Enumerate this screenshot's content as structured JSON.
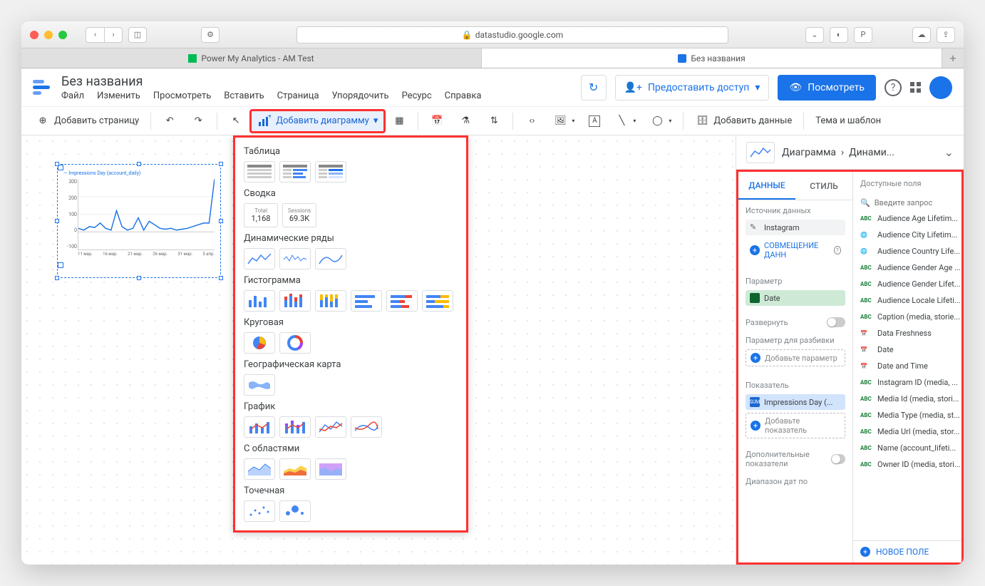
{
  "browser": {
    "url": "datastudio.google.com",
    "tabs": [
      {
        "label": "Power My Analytics - AM Test",
        "active": false
      },
      {
        "label": "Без названия",
        "active": true
      }
    ]
  },
  "doc_title": "Без названия",
  "menus": [
    "Файл",
    "Изменить",
    "Просмотреть",
    "Вставить",
    "Страница",
    "Упорядочить",
    "Ресурс",
    "Справка"
  ],
  "header_buttons": {
    "share": "Предоставить доступ",
    "view": "Посмотреть"
  },
  "toolbar": {
    "add_page": "Добавить страницу",
    "add_chart": "Добавить диаграмму",
    "add_data": "Добавить данные",
    "theme": "Тема и шаблон"
  },
  "dropdown": {
    "sections": {
      "table": "Таблица",
      "summary": "Сводка",
      "timeseries": "Динамические ряды",
      "histogram": "Гистограмма",
      "pie": "Круговая",
      "geo": "Географическая карта",
      "chart": "График",
      "area": "С областями",
      "scatter": "Точечная"
    },
    "summary_tiles": [
      {
        "label": "Total",
        "value": "1,168"
      },
      {
        "label": "Sessions",
        "value": "69.3K"
      }
    ]
  },
  "chart_data": {
    "type": "line",
    "title": "",
    "legend": "Impressions Day (account_daily)",
    "xlabel": "",
    "ylabel": "",
    "ylim": [
      -100,
      300
    ],
    "y_ticks": [
      300,
      200,
      100,
      0,
      -100
    ],
    "categories": [
      "11 мар.",
      "16 мар.",
      "21 мар.",
      "26 мар.",
      "31 мар.",
      "5 апр."
    ],
    "series": [
      {
        "name": "Impressions Day (account_daily)",
        "color": "#1a73e8",
        "values": [
          20,
          10,
          30,
          25,
          50,
          20,
          10,
          120,
          30,
          10,
          20,
          80,
          10,
          60,
          40,
          20,
          15,
          20,
          10,
          15,
          20,
          30,
          40,
          50,
          50,
          300
        ]
      }
    ]
  },
  "panel": {
    "breadcrumb_chart": "Диаграмма",
    "breadcrumb_type": "Динами...",
    "tabs": {
      "data": "ДАННЫЕ",
      "style": "СТИЛЬ"
    },
    "source_label": "Источник данных",
    "source_name": "Instagram",
    "blend_label": "СОВМЕЩЕНИЕ ДАНН",
    "dimension_label": "Параметр",
    "dimension_value": "Date",
    "expand_label": "Развернуть",
    "breakdown_label": "Параметр для разбивки",
    "add_dimension": "Добавьте параметр",
    "metric_label": "Показатель",
    "metric_value": "Impressions Day (...",
    "metric_agg": "SUM",
    "add_metric": "Добавьте показатель",
    "optional_metrics": "Дополнительные показатели",
    "date_range": "Диапазон дат по",
    "fields_header": "Доступные поля",
    "search_placeholder": "Введите запрос",
    "fields": [
      {
        "type": "abc",
        "name": "Audience Age Lifetim..."
      },
      {
        "type": "geo",
        "name": "Audience City Lifetim..."
      },
      {
        "type": "geo",
        "name": "Audience Country Life..."
      },
      {
        "type": "abc",
        "name": "Audience Gender Age ..."
      },
      {
        "type": "abc",
        "name": "Audience Gender Lifet..."
      },
      {
        "type": "abc",
        "name": "Audience Locale Lifeti..."
      },
      {
        "type": "abc",
        "name": "Caption (media, storie..."
      },
      {
        "type": "cal",
        "name": "Data Freshness"
      },
      {
        "type": "cal",
        "name": "Date"
      },
      {
        "type": "cal",
        "name": "Date and Time"
      },
      {
        "type": "abc",
        "name": "Instagram ID (media, ..."
      },
      {
        "type": "abc",
        "name": "Media Id (media, stori..."
      },
      {
        "type": "abc",
        "name": "Media Type (media, st..."
      },
      {
        "type": "abc",
        "name": "Media Url (media, stor..."
      },
      {
        "type": "abc",
        "name": "Name (account_lifeti..."
      },
      {
        "type": "abc",
        "name": "Owner ID (media, stori..."
      }
    ],
    "new_field": "НОВОЕ ПОЛЕ"
  }
}
